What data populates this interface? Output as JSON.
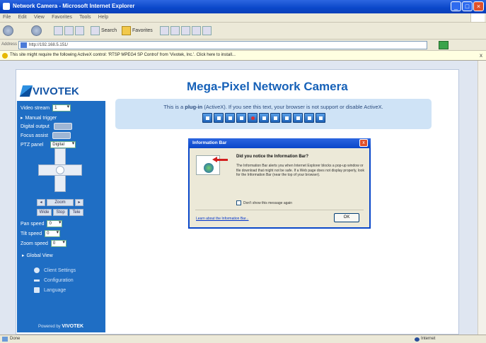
{
  "window": {
    "title": "Network Camera - Microsoft Internet Explorer",
    "menu": [
      "File",
      "Edit",
      "View",
      "Favorites",
      "Tools",
      "Help"
    ]
  },
  "toolbar": {
    "search": "Search",
    "favorites": "Favorites"
  },
  "address": {
    "label": "Address",
    "url": "http://192.168.5.151/"
  },
  "infobar": {
    "text": "This site might require the following ActiveX control: 'RTSP MPEG4 SP Control' from 'Vivotek, Inc.'. Click here to install...",
    "close": "x"
  },
  "brand": {
    "logo_text": "VIVOTEK",
    "powered": "Powered by",
    "powered_brand": "VIVOTEK"
  },
  "sidebar": {
    "video_stream_label": "Video stream",
    "video_stream_value": "1",
    "manual_trigger": "Manual trigger",
    "digital_output": "Digital output",
    "focus_assist": "Focus assist",
    "ptz_panel_label": "PTZ panel",
    "ptz_panel_value": "Digital",
    "zoom_buttons": [
      "Zoom",
      "Wide",
      "Stop",
      "Tele"
    ],
    "pan_speed_label": "Pan speed",
    "pan_speed_value": "0",
    "tilt_speed_label": "Tilt speed",
    "tilt_speed_value": "0",
    "zoom_speed_label": "Zoom speed",
    "zoom_speed_value": "0",
    "global_view": "Global View",
    "menu": [
      "Client Settings",
      "Configuration",
      "Language"
    ]
  },
  "main": {
    "title": "Mega-Pixel Network Camera",
    "plugin_prefix": "This is a ",
    "plugin_bold": "plug-in",
    "plugin_suffix": " (ActiveX). If you see this text, your browser is not support or disable ActiveX."
  },
  "dialog": {
    "title": "Information Bar",
    "close": "x",
    "heading": "Did you notice the Information Bar?",
    "body": "The Information Bar alerts you when Internet Explorer blocks a pop-up window or file download that might not be safe. If a Web page does not display properly, look for the Information Bar (near the top of your browser).",
    "checkbox": "Don't show this message again",
    "link": "Learn about the Information Bar...",
    "ok": "OK"
  },
  "status": {
    "left": "Done",
    "zone": "Internet"
  }
}
